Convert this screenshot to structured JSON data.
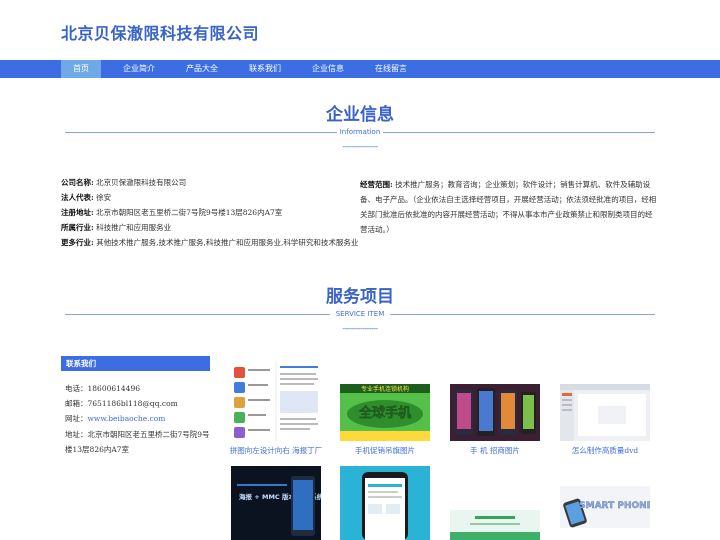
{
  "site": {
    "title": "北京贝保澈限科技有限公司"
  },
  "nav": {
    "items": [
      {
        "label": "首页",
        "active": true
      },
      {
        "label": "企业简介"
      },
      {
        "label": "产品大全"
      },
      {
        "label": "联系我们"
      },
      {
        "label": "企业信息"
      },
      {
        "label": "在线留言"
      }
    ]
  },
  "info_section": {
    "title": "企业信息",
    "subtitle": "Information",
    "dash": "----------------",
    "rows": [
      {
        "label": "公司名称:",
        "value": "北京贝保澈限科技有限公司"
      },
      {
        "label": "法人代表:",
        "value": "徐安"
      },
      {
        "label": "注册地址:",
        "value": "北京市朝阳区老五里桥二街7号院9号楼13层826内A7室"
      },
      {
        "label": "所属行业:",
        "value": "科技推广和应用服务业"
      },
      {
        "label": "更多行业:",
        "value": "其他技术推广服务,技术推广服务,科技推广和应用服务业,科学研究和技术服务业"
      }
    ],
    "scope_label": "经营范围:",
    "scope_text": "技术推广服务；教育咨询；企业策划；软件设计；销售计算机、软件及辅助设备、电子产品。（企业依法自主选择经营项目，开展经营活动；依法须经批准的项目，经相关部门批准后依批准的内容开展经营活动；不得从事本市产业政策禁止和限制类项目的经营活动。）"
  },
  "service_section": {
    "title": "服务项目",
    "subtitle": "SERVICE ITEM",
    "dash": "----------------"
  },
  "contact": {
    "heading": "联系我们",
    "phone_label": "电话：",
    "phone": "18600614496",
    "email_label": "邮箱：",
    "email": "7651186bl118@qq.com",
    "site_label": "网址：",
    "site": "www.beibaoche.com",
    "address_label": "地址：",
    "address": "北京市朝阳区老五里桥二街7号院9号楼13层826内A7室"
  },
  "products": [
    {
      "caption": "拼图向左设计向右 海报丁厂"
    },
    {
      "caption": "手机促销吊旗图片"
    },
    {
      "caption": "手 机 招商图片"
    },
    {
      "caption": "怎么制作高质量dvd"
    },
    {
      "caption": ""
    },
    {
      "caption": ""
    },
    {
      "caption": ""
    },
    {
      "caption": ""
    }
  ],
  "product_art": {
    "banner_top": "专业手机连锁机构",
    "banner_big": "全球手机",
    "mmc_text": "海报 + MMC 版本信息 系统手机",
    "smart_text": "SMART PHONE"
  }
}
